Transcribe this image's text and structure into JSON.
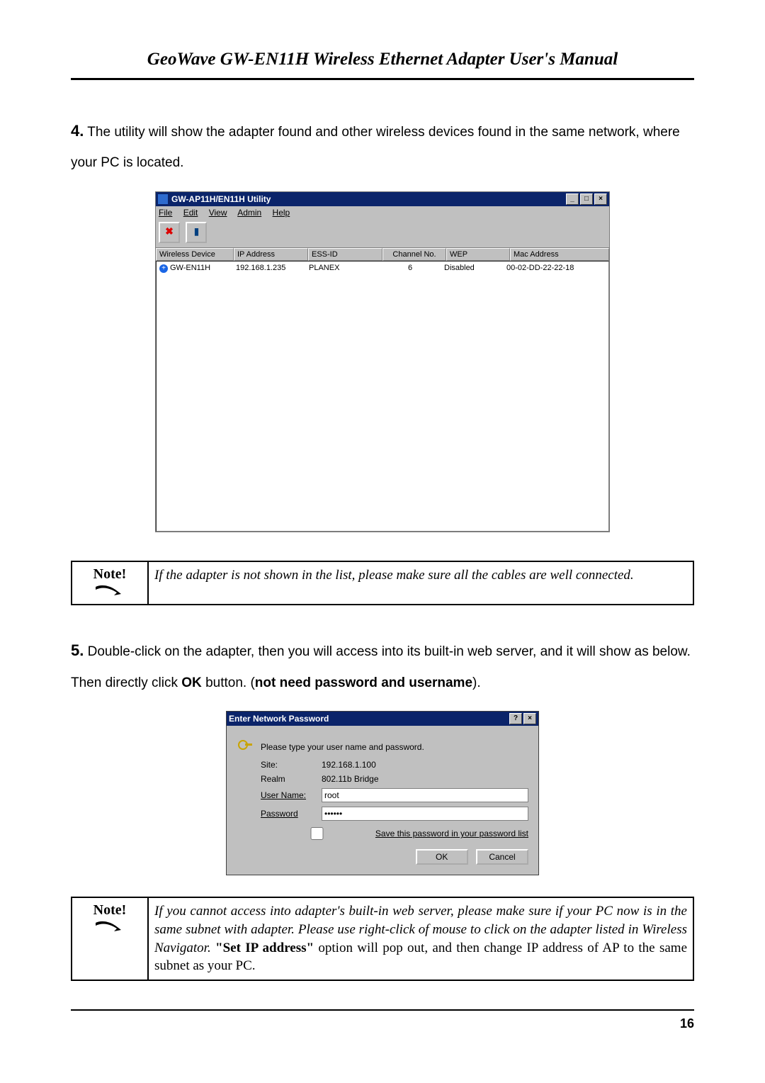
{
  "header": {
    "title": "GeoWave GW-EN11H Wireless Ethernet Adapter User's Manual"
  },
  "step4": {
    "num": "4.",
    "text": "The utility will show the adapter found and other wireless devices found in the same network, where your PC is located."
  },
  "utility_window": {
    "title": "GW-AP11H/EN11H Utility",
    "menu": {
      "file": "File",
      "edit": "Edit",
      "view": "View",
      "admin": "Admin",
      "help": "Help"
    },
    "cols": {
      "dev": "Wireless Device",
      "ip": "IP Address",
      "ess": "ESS-ID",
      "chan": "Channel No.",
      "wep": "WEP",
      "mac": "Mac Address"
    },
    "row": {
      "dev": "GW-EN11H",
      "ip": "192.168.1.235",
      "ess": "PLANEX",
      "chan": "6",
      "wep": "Disabled",
      "mac": "00-02-DD-22-22-18"
    }
  },
  "note1": {
    "label": "Note!",
    "text": "If the adapter is not shown in the list, please make sure all the cables are well connected."
  },
  "step5": {
    "num": "5.",
    "part1": "Double-click on the adapter, then you will access into its built-in web server, and it will show as below. Then directly click ",
    "ok": "OK",
    "part2": " button. (",
    "no_cred": "not need password and username",
    "part3": ")."
  },
  "dialog": {
    "title": "Enter Network Password",
    "prompt": "Please type your user name and password.",
    "site_l": "Site:",
    "site_v": "192.168.1.100",
    "realm_l": "Realm",
    "realm_v": "802.11b Bridge",
    "user_l": "User Name:",
    "user_v": "root",
    "pass_l": "Password",
    "pass_v": "xxxxxx",
    "save": "Save this password in your password list",
    "ok": "OK",
    "cancel": "Cancel"
  },
  "note2": {
    "label": "Note!",
    "l1": "If you cannot access into adapter's built-in web server, please make sure if your PC now is in the same subnet with adapter. Please use right-click of mouse to click on the adapter listed in Wireless Navigator. ",
    "setip": "\"Set IP address\"",
    "l2": " option will pop out, and then change IP address of AP to the same subnet as your PC."
  },
  "page_num": "16"
}
